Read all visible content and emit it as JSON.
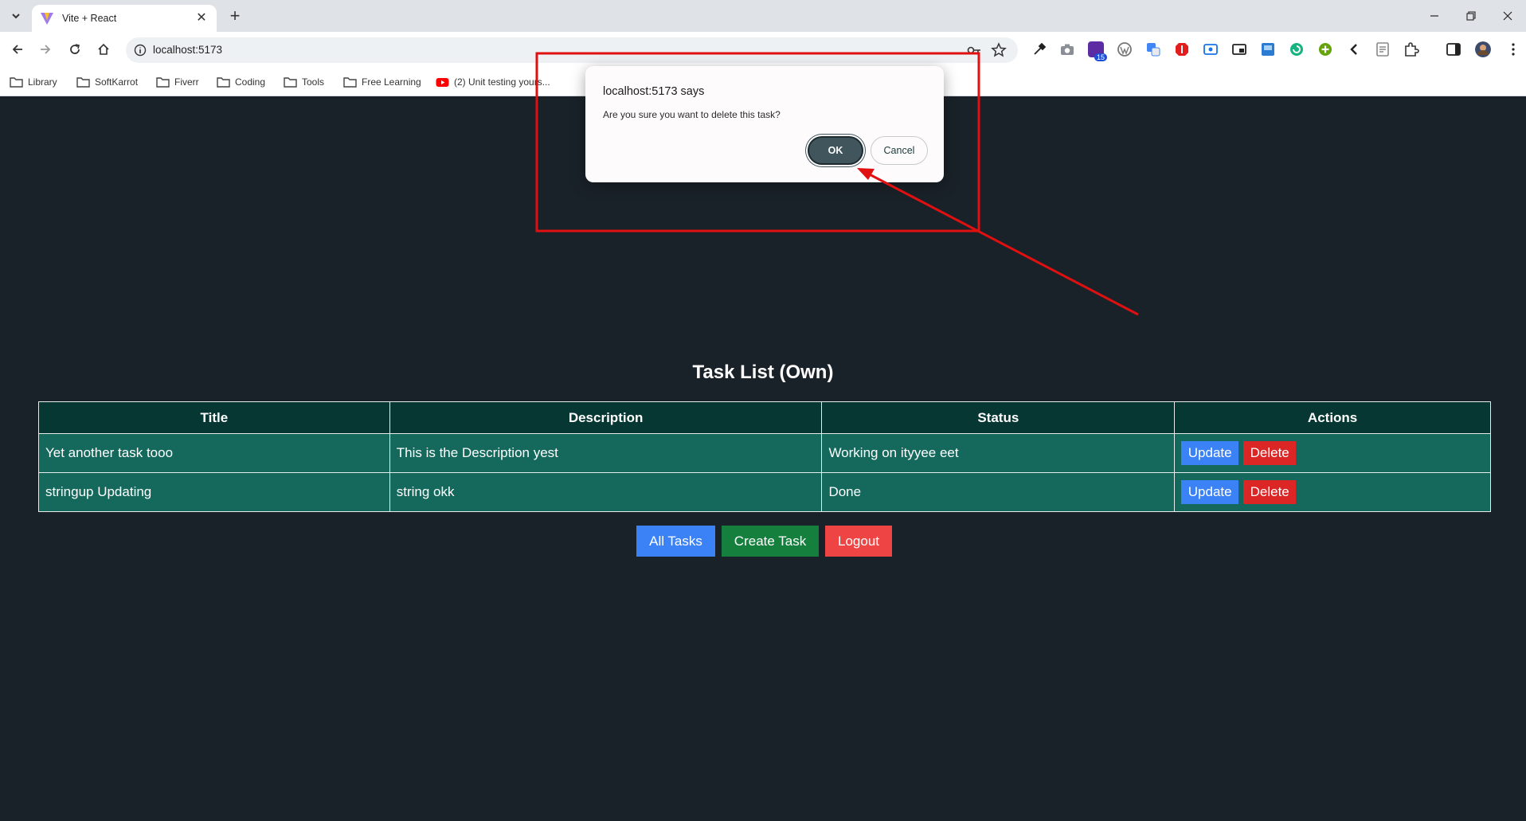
{
  "browser": {
    "tab_title": "Vite + React",
    "url": "localhost:5173",
    "bookmarks": [
      {
        "label": "Library",
        "icon": "folder-icon"
      },
      {
        "label": "SoftKarrot",
        "icon": "folder-icon"
      },
      {
        "label": "Fiverr",
        "icon": "folder-icon"
      },
      {
        "label": "Coding",
        "icon": "folder-icon"
      },
      {
        "label": "Tools",
        "icon": "folder-icon"
      },
      {
        "label": "Free Learning",
        "icon": "folder-icon"
      },
      {
        "label": "(2) Unit testing yours...",
        "icon": "youtube-icon"
      }
    ],
    "extension_badge": "15"
  },
  "dialog": {
    "title": "localhost:5173 says",
    "message": "Are you sure you want to delete this task?",
    "ok_label": "OK",
    "cancel_label": "Cancel"
  },
  "page": {
    "title": "Task List (Own)",
    "columns": [
      "Title",
      "Description",
      "Status",
      "Actions"
    ],
    "rows": [
      {
        "title": "Yet another task tooo",
        "description": "This is the Description yest",
        "status": "Working on ityyee eet",
        "update_label": "Update",
        "delete_label": "Delete"
      },
      {
        "title": "stringup Updating",
        "description": "string okk",
        "status": "Done",
        "update_label": "Update",
        "delete_label": "Delete"
      }
    ],
    "buttons": {
      "all_tasks": "All Tasks",
      "create_task": "Create Task",
      "logout": "Logout"
    }
  },
  "colors": {
    "page_bg": "#1a2229",
    "header_bg": "#063732",
    "row_bg": "#14695c",
    "blue": "#3b82f6",
    "red": "#dc2626",
    "green": "#15803d",
    "annotation": "#e01010"
  }
}
